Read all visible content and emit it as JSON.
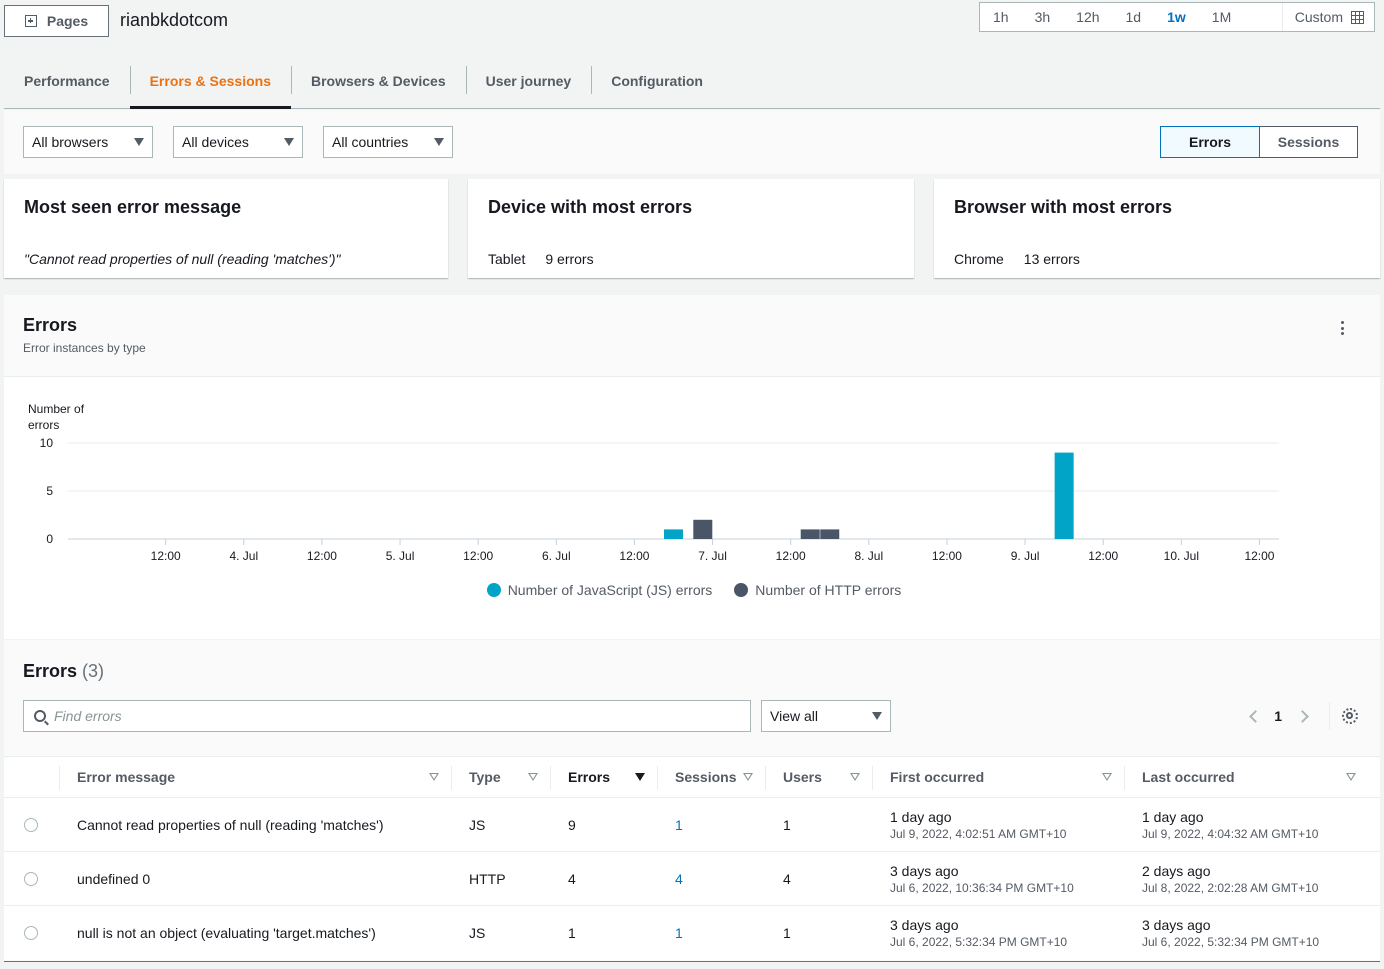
{
  "header": {
    "pages_label": "Pages",
    "app_title": "rianbkdotcom",
    "time_ranges": [
      "1h",
      "3h",
      "12h",
      "1d",
      "1w",
      "1M"
    ],
    "time_range_active": "1w",
    "custom_label": "Custom"
  },
  "tabs": [
    {
      "label": "Performance",
      "active": false
    },
    {
      "label": "Errors & Sessions",
      "active": true
    },
    {
      "label": "Browsers & Devices",
      "active": false
    },
    {
      "label": "User journey",
      "active": false
    },
    {
      "label": "Configuration",
      "active": false
    }
  ],
  "filters": {
    "browsers": "All browsers",
    "devices": "All devices",
    "countries": "All countries",
    "view_toggle": [
      {
        "label": "Errors",
        "active": true
      },
      {
        "label": "Sessions",
        "active": false
      }
    ]
  },
  "summary_cards": [
    {
      "title": "Most seen error message",
      "value": "\"Cannot read properties of null (reading 'matches')\""
    },
    {
      "title": "Device with most errors",
      "name": "Tablet",
      "value": "9 errors"
    },
    {
      "title": "Browser with most errors",
      "name": "Chrome",
      "value": "13 errors"
    }
  ],
  "chart_panel": {
    "title": "Errors",
    "subtitle": "Error instances by type"
  },
  "chart_data": {
    "type": "bar",
    "title": "Errors",
    "subtitle": "Error instances by type",
    "ylabel": "Number of errors",
    "xlabel": "",
    "ylim": [
      0,
      10
    ],
    "yticks": [
      0,
      5,
      10
    ],
    "xrange_hours_from_3jul_00": [
      -3,
      183
    ],
    "xticks": [
      {
        "label": "12:00",
        "h": 12
      },
      {
        "label": "4. Jul",
        "h": 24
      },
      {
        "label": "12:00",
        "h": 36
      },
      {
        "label": "5. Jul",
        "h": 48
      },
      {
        "label": "12:00",
        "h": 60
      },
      {
        "label": "6. Jul",
        "h": 72
      },
      {
        "label": "12:00",
        "h": 84
      },
      {
        "label": "7. Jul",
        "h": 96
      },
      {
        "label": "12:00",
        "h": 108
      },
      {
        "label": "8. Jul",
        "h": 120
      },
      {
        "label": "12:00",
        "h": 132
      },
      {
        "label": "9. Jul",
        "h": 144
      },
      {
        "label": "12:00",
        "h": 156
      },
      {
        "label": "10. Jul",
        "h": 168
      },
      {
        "label": "12:00",
        "h": 180
      }
    ],
    "grid": true,
    "legend_position": "bottom",
    "series": [
      {
        "name": "Number of JavaScript (JS) errors",
        "color": "#01a4c6",
        "points": [
          {
            "h": 90,
            "value": 1
          },
          {
            "h": 150,
            "value": 9
          }
        ]
      },
      {
        "name": "Number of HTTP errors",
        "color": "#4a5668",
        "points": [
          {
            "h": 94.5,
            "value": 2
          },
          {
            "h": 111,
            "value": 1
          },
          {
            "h": 114,
            "value": 1
          }
        ]
      }
    ]
  },
  "errors_table": {
    "title": "Errors",
    "count": "(3)",
    "search_placeholder": "Find errors",
    "view_filter": "View all",
    "page": "1",
    "columns": [
      "Error message",
      "Type",
      "Errors",
      "Sessions",
      "Users",
      "First occurred",
      "Last occurred"
    ],
    "rows": [
      {
        "message": "Cannot read properties of null (reading 'matches')",
        "type": "JS",
        "errors": "9",
        "sessions": "1",
        "users": "1",
        "first_rel": "1 day ago",
        "first_abs": "Jul 9, 2022, 4:02:51 AM GMT+10",
        "last_rel": "1 day ago",
        "last_abs": "Jul 9, 2022, 4:04:32 AM GMT+10"
      },
      {
        "message": "undefined 0",
        "type": "HTTP",
        "errors": "4",
        "sessions": "4",
        "users": "4",
        "first_rel": "3 days ago",
        "first_abs": "Jul 6, 2022, 10:36:34 PM GMT+10",
        "last_rel": "2 days ago",
        "last_abs": "Jul 8, 2022, 2:02:28 AM GMT+10"
      },
      {
        "message": "null is not an object (evaluating 'target.matches')",
        "type": "JS",
        "errors": "1",
        "sessions": "1",
        "users": "1",
        "first_rel": "3 days ago",
        "first_abs": "Jul 6, 2022, 5:32:34 PM GMT+10",
        "last_rel": "3 days ago",
        "last_abs": "Jul 6, 2022, 5:32:34 PM GMT+10"
      }
    ]
  }
}
